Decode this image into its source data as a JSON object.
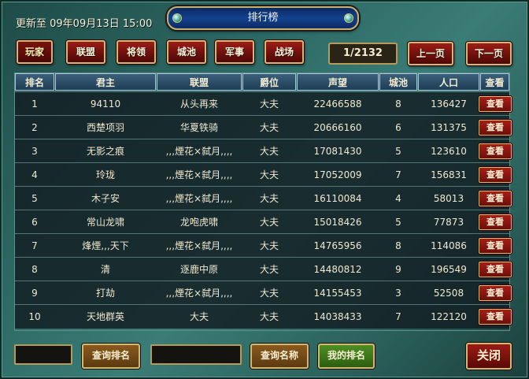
{
  "header": {
    "updated_text": "更新至 09年09月13日 15:00",
    "title": "排行榜"
  },
  "tabs": [
    {
      "label": "玩家",
      "active": true
    },
    {
      "label": "联盟",
      "active": false
    },
    {
      "label": "将领",
      "active": false
    },
    {
      "label": "城池",
      "active": false
    },
    {
      "label": "军事",
      "active": false
    },
    {
      "label": "战场",
      "active": false
    }
  ],
  "pager": {
    "indicator": "1/2132",
    "prev_label": "上一页",
    "next_label": "下一页"
  },
  "table": {
    "columns": [
      "排名",
      "君主",
      "联盟",
      "爵位",
      "声望",
      "城池",
      "人口",
      "查看"
    ],
    "view_label": "查看",
    "rows": [
      {
        "rank": "1",
        "lord": "94110",
        "alliance": "从头再来",
        "title": "大夫",
        "prestige": "22466588",
        "cities": "8",
        "population": "136427"
      },
      {
        "rank": "2",
        "lord": "西楚项羽",
        "alliance": "华夏铁骑",
        "title": "大夫",
        "prestige": "20666160",
        "cities": "6",
        "population": "131375"
      },
      {
        "rank": "3",
        "lord": "无影之痕",
        "alliance": ",,,煙花×弑月,,,,",
        "title": "大夫",
        "prestige": "17081430",
        "cities": "5",
        "population": "123610"
      },
      {
        "rank": "4",
        "lord": "玲珑",
        "alliance": ",,,煙花×弑月,,,,",
        "title": "大夫",
        "prestige": "17052009",
        "cities": "7",
        "population": "156831"
      },
      {
        "rank": "5",
        "lord": "木子安",
        "alliance": ",,,煙花×弑月,,,,",
        "title": "大夫",
        "prestige": "16110084",
        "cities": "4",
        "population": "58013"
      },
      {
        "rank": "6",
        "lord": "常山龙啸",
        "alliance": "龙咆虎啸",
        "title": "大夫",
        "prestige": "15018426",
        "cities": "5",
        "population": "77873"
      },
      {
        "rank": "7",
        "lord": "烽煙,,,天下",
        "alliance": ",,,煙花×弑月,,,,",
        "title": "大夫",
        "prestige": "14765956",
        "cities": "8",
        "population": "114086"
      },
      {
        "rank": "8",
        "lord": "清",
        "alliance": "逐鹿中原",
        "title": "大夫",
        "prestige": "14480812",
        "cities": "9",
        "population": "196549"
      },
      {
        "rank": "9",
        "lord": "打劫",
        "alliance": ",,,煙花×弑月,,,,",
        "title": "大夫",
        "prestige": "14155453",
        "cities": "3",
        "population": "52508"
      },
      {
        "rank": "10",
        "lord": "天地群英",
        "alliance": "大夫",
        "title": "大夫",
        "prestige": "14038433",
        "cities": "7",
        "population": "122120"
      }
    ]
  },
  "footer": {
    "rank_input_value": "",
    "query_rank_label": "查询排名",
    "name_input_value": "",
    "query_name_label": "查询名称",
    "my_rank_label": "我的排名",
    "close_label": "关闭"
  }
}
